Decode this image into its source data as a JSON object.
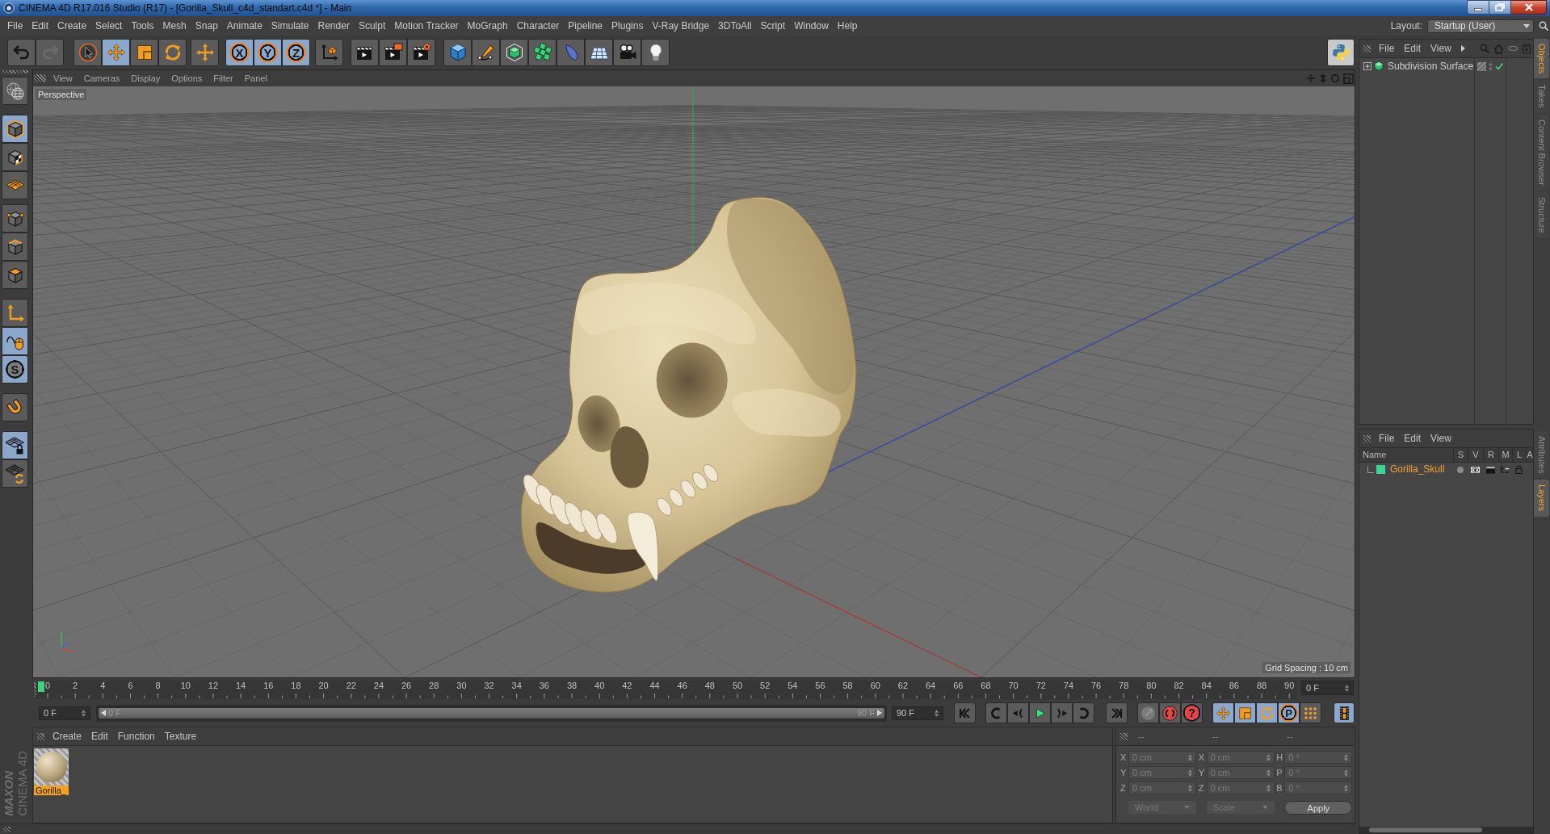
{
  "window": {
    "title": "CINEMA 4D R17.016 Studio (R17) - [Gorilla_Skull_c4d_standart.c4d *] - Main"
  },
  "menu_bar": {
    "items": [
      "File",
      "Edit",
      "Create",
      "Select",
      "Tools",
      "Mesh",
      "Snap",
      "Animate",
      "Simulate",
      "Render",
      "Sculpt",
      "Motion Tracker",
      "MoGraph",
      "Character",
      "Pipeline",
      "Plugins",
      "V-Ray Bridge",
      "3DToAll",
      "Script",
      "Window",
      "Help"
    ],
    "layout_label": "Layout:",
    "layout_value": "Startup (User)"
  },
  "toolbar": {
    "groups": [
      [
        {
          "kind": "undo",
          "active": false,
          "disabled": false
        },
        {
          "kind": "redo",
          "active": false,
          "disabled": true
        }
      ],
      [
        {
          "kind": "select",
          "active": false
        },
        {
          "kind": "move",
          "active": true
        },
        {
          "kind": "scale",
          "active": false
        },
        {
          "kind": "rotate",
          "active": false
        }
      ],
      [
        {
          "kind": "recent-tool",
          "active": false
        }
      ],
      [
        {
          "kind": "axis-lock",
          "label": "X",
          "active": true
        },
        {
          "kind": "axis-lock",
          "label": "Y",
          "active": true
        },
        {
          "kind": "axis-lock",
          "label": "Z",
          "active": true
        }
      ],
      [
        {
          "kind": "coordinate-system",
          "active": false
        }
      ],
      [
        {
          "kind": "render-view",
          "active": false
        },
        {
          "kind": "render-picture",
          "active": false
        },
        {
          "kind": "render-settings",
          "active": false
        }
      ],
      [
        {
          "kind": "cube",
          "active": false
        },
        {
          "kind": "pen",
          "active": false
        },
        {
          "kind": "subdivision",
          "active": false
        },
        {
          "kind": "cloner",
          "active": false
        },
        {
          "kind": "deformer",
          "active": false
        },
        {
          "kind": "floor",
          "active": false
        },
        {
          "kind": "camera",
          "active": false
        },
        {
          "kind": "light",
          "active": false
        }
      ]
    ],
    "python": {
      "kind": "python"
    }
  },
  "left_toolbar": {
    "groups": [
      [
        {
          "kind": "workplane-globe",
          "active": false
        }
      ],
      [
        {
          "kind": "model",
          "active": true
        },
        {
          "kind": "texture",
          "active": false
        },
        {
          "kind": "workplane",
          "active": false
        }
      ],
      [
        {
          "kind": "points",
          "active": false
        },
        {
          "kind": "edges",
          "active": false
        },
        {
          "kind": "polygons",
          "active": false
        }
      ],
      [
        {
          "kind": "axis",
          "active": false
        },
        {
          "kind": "tweak",
          "active": true
        },
        {
          "kind": "solo",
          "label": "S",
          "active": true
        }
      ],
      [
        {
          "kind": "snap",
          "active": false
        }
      ],
      [
        {
          "kind": "workplane-lock",
          "active": true
        },
        {
          "kind": "workplane-refresh",
          "active": false
        }
      ]
    ]
  },
  "logo": {
    "brand": "MAXON",
    "product": "CINEMA 4D"
  },
  "viewport": {
    "menu": [
      "View",
      "Cameras",
      "Display",
      "Options",
      "Filter",
      "Panel"
    ],
    "camera": "Perspective",
    "grid_spacing": "Grid Spacing : 10 cm"
  },
  "timeline": {
    "labels": [
      "0",
      "2",
      "4",
      "6",
      "8",
      "10",
      "12",
      "14",
      "16",
      "18",
      "20",
      "22",
      "24",
      "26",
      "28",
      "30",
      "32",
      "34",
      "36",
      "38",
      "40",
      "42",
      "44",
      "46",
      "48",
      "50",
      "52",
      "54",
      "56",
      "58",
      "60",
      "62",
      "64",
      "66",
      "68",
      "70",
      "72",
      "74",
      "76",
      "78",
      "80",
      "82",
      "84",
      "86",
      "88",
      "90"
    ],
    "playhead": {
      "level": 0
    },
    "current_frame": "0 F"
  },
  "frame_range": {
    "start": "0 F",
    "slider_start": "0 F",
    "slider_end": "90 F",
    "level": 1,
    "end": "90 F"
  },
  "transport": {
    "groups": [
      [
        {
          "kind": "go-start"
        }
      ],
      [
        {
          "kind": "prev-key"
        },
        {
          "kind": "prev-frame"
        },
        {
          "kind": "play"
        },
        {
          "kind": "next-frame"
        },
        {
          "kind": "next-key"
        }
      ],
      [
        {
          "kind": "go-end"
        }
      ],
      [
        {
          "kind": "record",
          "disabled": true
        },
        {
          "kind": "autokey",
          "disabled": false
        },
        {
          "kind": "key-selection",
          "label": "?",
          "disabled": false
        }
      ],
      [
        {
          "kind": "key-position",
          "active": true
        },
        {
          "kind": "key-scale",
          "active": true
        },
        {
          "kind": "key-rotation",
          "active": true
        },
        {
          "kind": "key-parameter",
          "label": "P",
          "active": true
        },
        {
          "kind": "key-pla",
          "active": false
        }
      ],
      [
        {
          "kind": "timeline",
          "active": true
        }
      ]
    ]
  },
  "material_manager": {
    "menu": [
      "Create",
      "Edit",
      "Function",
      "Texture"
    ],
    "materials": [
      {
        "name": "Gorilla_",
        "selected": true
      }
    ]
  },
  "coordinates": {
    "headers": [
      "--",
      "--",
      "--"
    ],
    "rows": [
      [
        {
          "axis": "X",
          "value": "0 cm"
        },
        {
          "axis": "X",
          "value": "0 cm"
        },
        {
          "axis": "H",
          "value": "0 °"
        }
      ],
      [
        {
          "axis": "Y",
          "value": "0 cm"
        },
        {
          "axis": "Y",
          "value": "0 cm"
        },
        {
          "axis": "P",
          "value": "0 °"
        }
      ],
      [
        {
          "axis": "Z",
          "value": "0 cm"
        },
        {
          "axis": "Z",
          "value": "0 cm"
        },
        {
          "axis": "B",
          "value": "0 °"
        }
      ]
    ],
    "dropdowns": [
      {
        "label": "World",
        "disabled": true
      },
      {
        "label": "Scale",
        "disabled": true
      }
    ],
    "apply": "Apply"
  },
  "objects_panel": {
    "menu": [
      "File",
      "Edit",
      "View"
    ],
    "objects": [
      {
        "name": "Subdivision Surface",
        "expanded": false,
        "enabled": true
      }
    ]
  },
  "layers_panel": {
    "menu": [
      "File",
      "Edit",
      "View"
    ],
    "columns": [
      "Name",
      "S",
      "V",
      "R",
      "M",
      "L",
      "A"
    ],
    "layers": [
      {
        "name": "Gorilla_Skull",
        "color": "#3bd59a",
        "selected": true
      }
    ]
  },
  "side_tabs": {
    "upper": [
      {
        "label": "Objects",
        "selected": true
      },
      {
        "label": "Takes",
        "selected": false
      },
      {
        "label": "Content Browser",
        "selected": false
      },
      {
        "label": "Structure",
        "selected": false
      }
    ],
    "lower": [
      {
        "label": "Attributes",
        "selected": false
      },
      {
        "label": "Layers",
        "selected": true
      }
    ]
  }
}
